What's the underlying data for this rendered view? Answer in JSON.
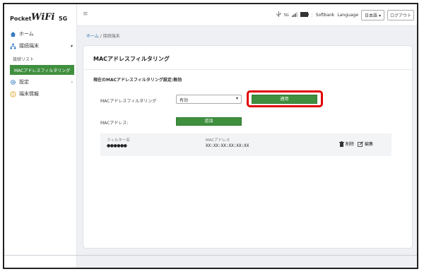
{
  "logo": {
    "part1": "Pocket",
    "part2": "WiFi",
    "part3": "5G"
  },
  "sidebar": {
    "items": [
      {
        "label": "ホーム"
      },
      {
        "label": "接続端末"
      },
      {
        "label": "接続リスト"
      },
      {
        "label": "MACアドレスフィルタリング"
      },
      {
        "label": "設定"
      },
      {
        "label": "端末情報"
      }
    ]
  },
  "topbar": {
    "menu_glyph": "≡",
    "signal_text": "5G",
    "carrier": "Softbank",
    "language_label": "Language",
    "language_value": "日本語",
    "logout_label": "ログアウト"
  },
  "breadcrumb": {
    "home": "ホーム",
    "sep": "/",
    "current": "接続端末"
  },
  "card": {
    "title": "MACアドレスフィルタリング",
    "status_note": "現在のMACアドレスフィルタリング設定:無効",
    "filter_label": "MACアドレスフィルタリング",
    "filter_value": "有効",
    "apply_label": "適用",
    "mac_label": "MACアドレス:",
    "add_label": "追加"
  },
  "entries": [
    {
      "filter_name_header": "フィルター名",
      "filter_name_value": "●●●●●●",
      "mac_header": "MACアドレス",
      "mac_value": "XX:XX:XX:XX:XX:XX",
      "delete_label": "削除",
      "edit_label": "編集"
    }
  ],
  "colors": {
    "accent_green": "#3f8f3f",
    "highlight_red": "#e00000",
    "link_blue": "#2a6fb0"
  }
}
